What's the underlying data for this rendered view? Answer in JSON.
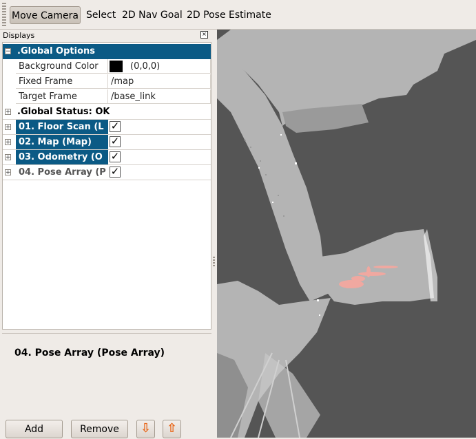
{
  "toolbar": {
    "tools": [
      "Move Camera",
      "Select",
      "2D Nav Goal",
      "2D Pose Estimate"
    ],
    "active_tool": "Move Camera"
  },
  "displays_panel": {
    "title": "Displays",
    "global_options": {
      "label": ".Global Options",
      "expand_symbol": "−",
      "properties": [
        {
          "name": "Background Color",
          "value": "(0,0,0)",
          "swatch_color": "#000000"
        },
        {
          "name": "Fixed Frame",
          "value": "/map"
        },
        {
          "name": "Target Frame",
          "value": "/base_link"
        }
      ]
    },
    "global_status": {
      "label": ".Global Status: OK",
      "expand_symbol": "+"
    },
    "displays": [
      {
        "label": "01. Floor Scan (L",
        "enabled": true,
        "selected": true
      },
      {
        "label": "02. Map (Map)",
        "enabled": true,
        "selected": true
      },
      {
        "label": "03. Odometry (O",
        "enabled": true,
        "selected": true
      },
      {
        "label": "04. Pose Array (P",
        "enabled": true,
        "selected": false
      }
    ],
    "check_glyph": "✓",
    "expand_glyph": "+"
  },
  "description": {
    "text": "04. Pose Array (Pose Array)"
  },
  "buttons": {
    "add": "Add",
    "remove": "Remove",
    "down_glyph": "⇩",
    "up_glyph": "⇧"
  },
  "colors": {
    "selection": "#0b5a85",
    "map_unknown": "#555555",
    "map_free": "#b4b4b4",
    "pose_points": "#f0a8a0"
  }
}
